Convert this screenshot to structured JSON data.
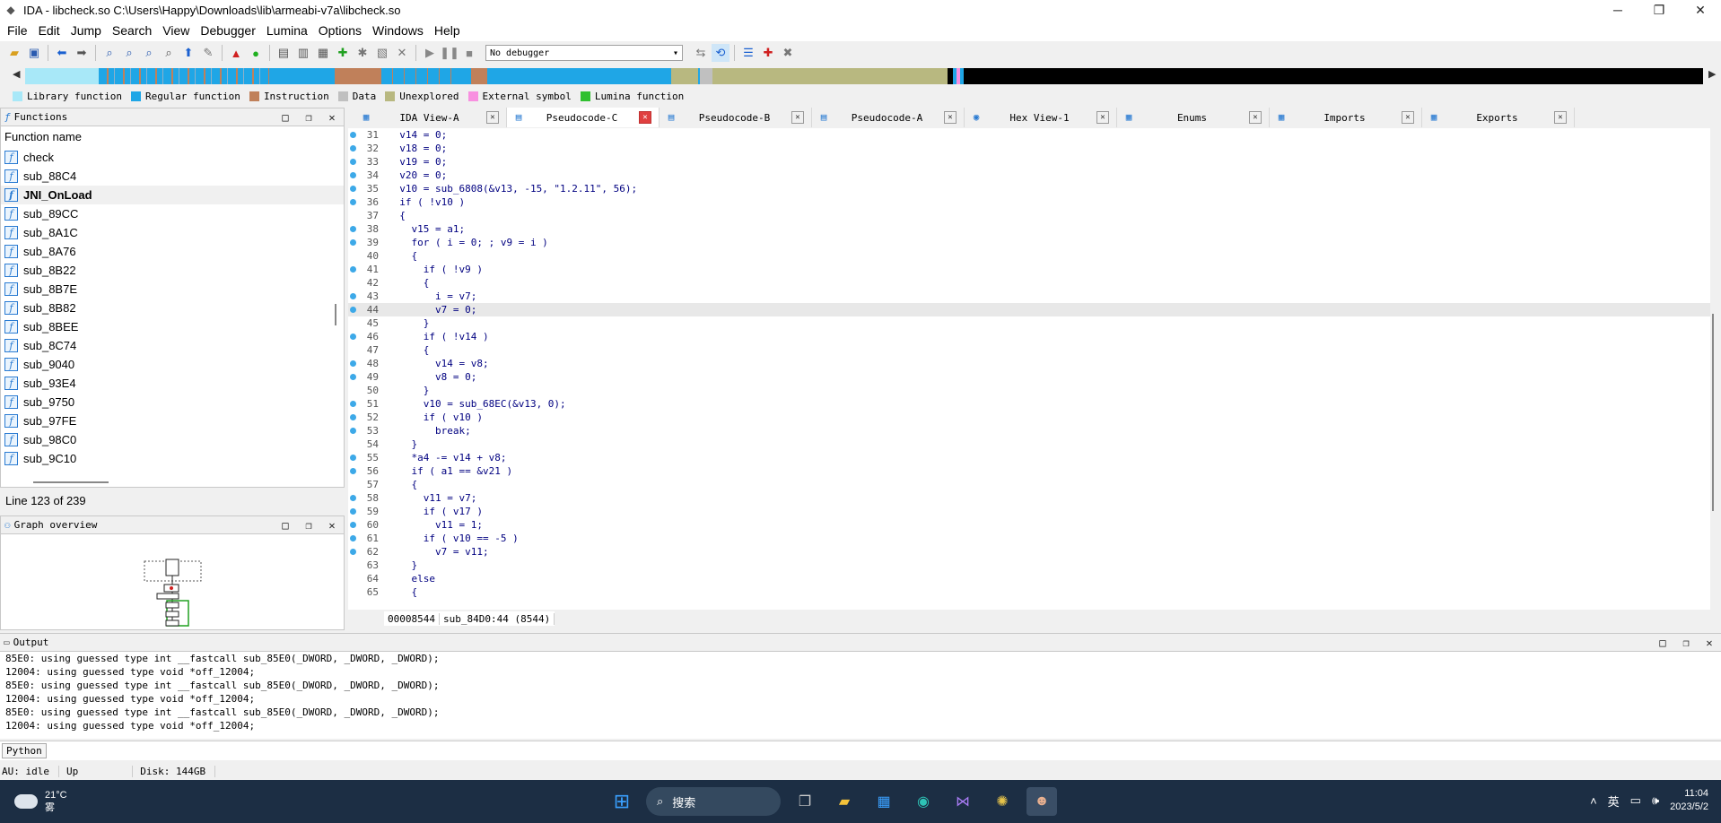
{
  "window": {
    "title": "IDA - libcheck.so C:\\Users\\Happy\\Downloads\\lib\\armeabi-v7a\\libcheck.so",
    "minimize": "─",
    "maximize": "❐",
    "close": "✕"
  },
  "menu": [
    "File",
    "Edit",
    "Jump",
    "Search",
    "View",
    "Debugger",
    "Lumina",
    "Options",
    "Windows",
    "Help"
  ],
  "toolbar": {
    "debugger_select": "No debugger"
  },
  "legend": [
    {
      "label": "Library function",
      "color": "#a8e8f8"
    },
    {
      "label": "Regular function",
      "color": "#1fa6e6"
    },
    {
      "label": "Instruction",
      "color": "#c0805a"
    },
    {
      "label": "Data",
      "color": "#c0c0c0"
    },
    {
      "label": "Unexplored",
      "color": "#b8b880"
    },
    {
      "label": "External symbol",
      "color": "#f890e0"
    },
    {
      "label": "Lumina function",
      "color": "#30c030"
    }
  ],
  "functions_panel": {
    "title": "Functions",
    "column": "Function name",
    "items": [
      "check",
      "sub_88C4",
      "JNI_OnLoad",
      "sub_89CC",
      "sub_8A1C",
      "sub_8A76",
      "sub_8B22",
      "sub_8B7E",
      "sub_8B82",
      "sub_8BEE",
      "sub_8C74",
      "sub_9040",
      "sub_93E4",
      "sub_9750",
      "sub_97FE",
      "sub_98C0",
      "sub_9C10"
    ],
    "selected": "JNI_OnLoad",
    "line_info": "Line 123 of 239"
  },
  "graph_panel": {
    "title": "Graph overview"
  },
  "tabs": [
    {
      "label": "IDA View-A",
      "active": false
    },
    {
      "label": "Pseudocode-C",
      "active": true
    },
    {
      "label": "Pseudocode-B",
      "active": false
    },
    {
      "label": "Pseudocode-A",
      "active": false
    },
    {
      "label": "Hex View-1",
      "active": false
    },
    {
      "label": "Enums",
      "active": false
    },
    {
      "label": "Imports",
      "active": false
    },
    {
      "label": "Exports",
      "active": false
    }
  ],
  "code": [
    {
      "n": "31",
      "t": "  v14 = 0;",
      "bp": true
    },
    {
      "n": "32",
      "t": "  v18 = 0;",
      "bp": true
    },
    {
      "n": "33",
      "t": "  v19 = 0;",
      "bp": true
    },
    {
      "n": "34",
      "t": "  v20 = 0;",
      "bp": true
    },
    {
      "n": "35",
      "t": "  v10 = sub_6808(&v13, -15, \"1.2.11\", 56);",
      "bp": true
    },
    {
      "n": "36",
      "t": "  if ( !v10 )",
      "bp": true
    },
    {
      "n": "37",
      "t": "  {",
      "bp": false
    },
    {
      "n": "38",
      "t": "    v15 = a1;",
      "bp": true
    },
    {
      "n": "39",
      "t": "    for ( i = 0; ; v9 = i )",
      "bp": true
    },
    {
      "n": "40",
      "t": "    {",
      "bp": false
    },
    {
      "n": "41",
      "t": "      if ( !v9 )",
      "bp": true
    },
    {
      "n": "42",
      "t": "      {",
      "bp": false
    },
    {
      "n": "43",
      "t": "        i = v7;",
      "bp": true
    },
    {
      "n": "44",
      "t": "        v7 = 0;",
      "bp": true,
      "cur": true
    },
    {
      "n": "45",
      "t": "      }",
      "bp": false
    },
    {
      "n": "46",
      "t": "      if ( !v14 )",
      "bp": true
    },
    {
      "n": "47",
      "t": "      {",
      "bp": false
    },
    {
      "n": "48",
      "t": "        v14 = v8;",
      "bp": true
    },
    {
      "n": "49",
      "t": "        v8 = 0;",
      "bp": true
    },
    {
      "n": "50",
      "t": "      }",
      "bp": false
    },
    {
      "n": "51",
      "t": "      v10 = sub_68EC(&v13, 0);",
      "bp": true
    },
    {
      "n": "52",
      "t": "      if ( v10 )",
      "bp": true
    },
    {
      "n": "53",
      "t": "        break;",
      "bp": true
    },
    {
      "n": "54",
      "t": "    }",
      "bp": false
    },
    {
      "n": "55",
      "t": "    *a4 -= v14 + v8;",
      "bp": true
    },
    {
      "n": "56",
      "t": "    if ( a1 == &v21 )",
      "bp": true
    },
    {
      "n": "57",
      "t": "    {",
      "bp": false
    },
    {
      "n": "58",
      "t": "      v11 = v7;",
      "bp": true
    },
    {
      "n": "59",
      "t": "      if ( v17 )",
      "bp": true
    },
    {
      "n": "60",
      "t": "        v11 = 1;",
      "bp": true
    },
    {
      "n": "61",
      "t": "      if ( v10 == -5 )",
      "bp": true
    },
    {
      "n": "62",
      "t": "        v7 = v11;",
      "bp": true
    },
    {
      "n": "63",
      "t": "    }",
      "bp": false
    },
    {
      "n": "64",
      "t": "    else",
      "bp": false
    },
    {
      "n": "65",
      "t": "    {",
      "bp": false
    }
  ],
  "code_status": {
    "addr": "00008544",
    "loc": "sub_84D0:44 (8544)"
  },
  "output": {
    "title": "Output",
    "lines": [
      "85E0: using guessed type int __fastcall sub_85E0(_DWORD, _DWORD, _DWORD);",
      "12004: using guessed type void *off_12004;",
      "85E0: using guessed type int __fastcall sub_85E0(_DWORD, _DWORD, _DWORD);",
      "12004: using guessed type void *off_12004;",
      "85E0: using guessed type int __fastcall sub_85E0(_DWORD, _DWORD, _DWORD);",
      "12004: using guessed type void *off_12004;"
    ],
    "python_btn": "Python"
  },
  "statusbar": {
    "au": "AU:  idle",
    "dir": "Up",
    "disk": "Disk: 144GB"
  },
  "taskbar": {
    "temp": "21°C",
    "weather": "雾",
    "search": "搜索",
    "ime": "英",
    "time": "11:04",
    "date": "2023/5/2"
  }
}
